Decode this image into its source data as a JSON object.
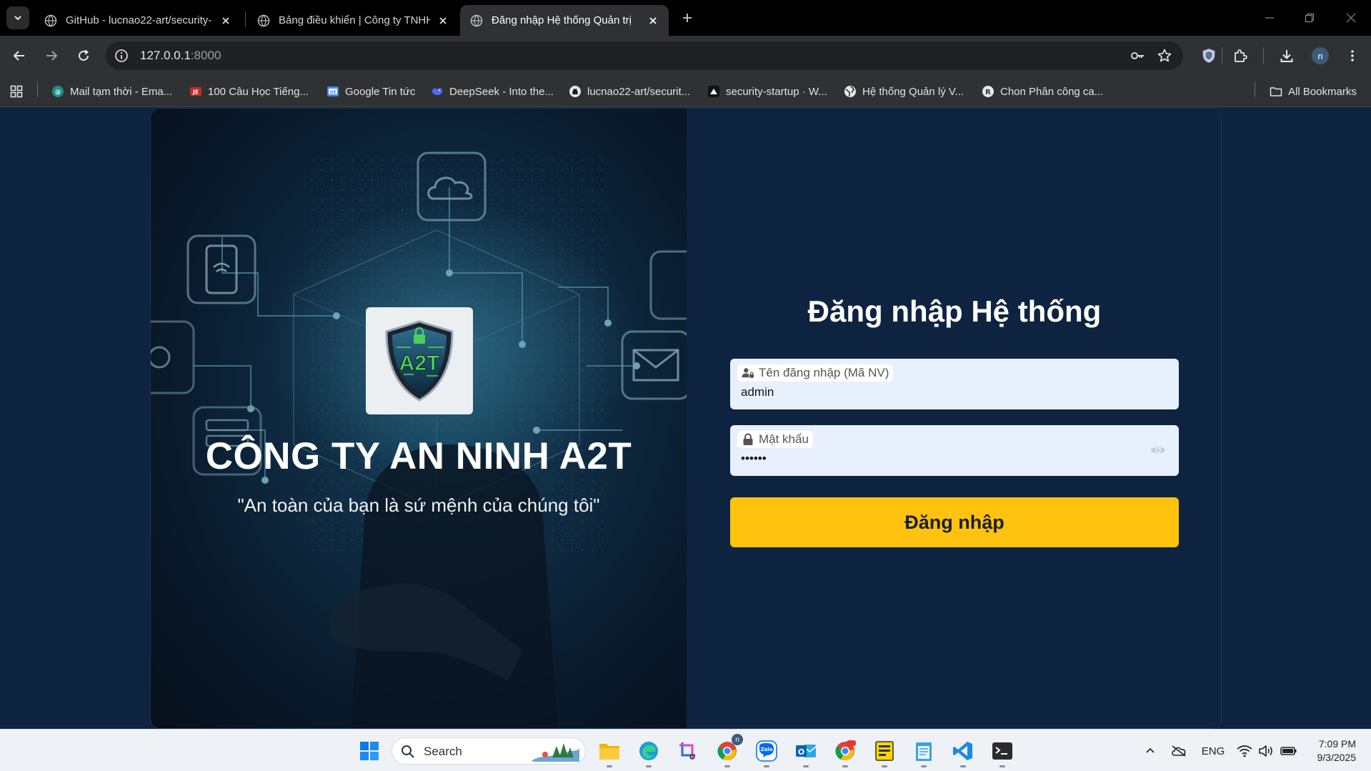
{
  "browser": {
    "tabs": [
      {
        "title": "GitHub - lucnao22-art/security-",
        "active": false
      },
      {
        "title": "Bảng điều khiển | Công ty TNHH",
        "active": false
      },
      {
        "title": "Đăng nhập Hệ thống Quản trị",
        "active": true
      }
    ],
    "url_host": "127.0.0.1",
    "url_port": ":8000",
    "profile_initial": "n",
    "bookmarks": [
      {
        "label": "Mail tạm thời - Ema...",
        "icon": "mail-globe-icon"
      },
      {
        "label": "100 Câu Học Tiếng...",
        "icon": "dictionary-icon"
      },
      {
        "label": "Google Tin tức",
        "icon": "google-news-icon"
      },
      {
        "label": "DeepSeek - Into the...",
        "icon": "deepseek-icon"
      },
      {
        "label": "lucnao22-art/securit...",
        "icon": "github-icon"
      },
      {
        "label": "security-startup · W...",
        "icon": "vercel-icon"
      },
      {
        "label": "Hệ thống Quản lý V...",
        "icon": "globe-icon"
      },
      {
        "label": "Chon Phân công ca...",
        "icon": "render-icon"
      }
    ],
    "all_bookmarks_label": "All Bookmarks"
  },
  "hero": {
    "logo_text": "A2T",
    "company_name": "CÔNG TY AN NINH A2T",
    "slogan": "\"An toàn của bạn là sứ mệnh của chúng tôi\""
  },
  "login": {
    "title": "Đăng nhập Hệ thống",
    "username_label": "Tên đăng nhập (Mã NV)",
    "username_value": "admin",
    "password_label": "Mật khẩu",
    "password_value": "••••••",
    "submit_label": "Đăng nhập"
  },
  "taskbar": {
    "search_placeholder": "Search",
    "language": "ENG",
    "time": "7:09 PM",
    "date": "9/3/2025",
    "chrome_badge": "n"
  },
  "colors": {
    "page_bg": "#0e2340",
    "button": "#ffc20e",
    "input_bg": "#e8f0fe"
  }
}
